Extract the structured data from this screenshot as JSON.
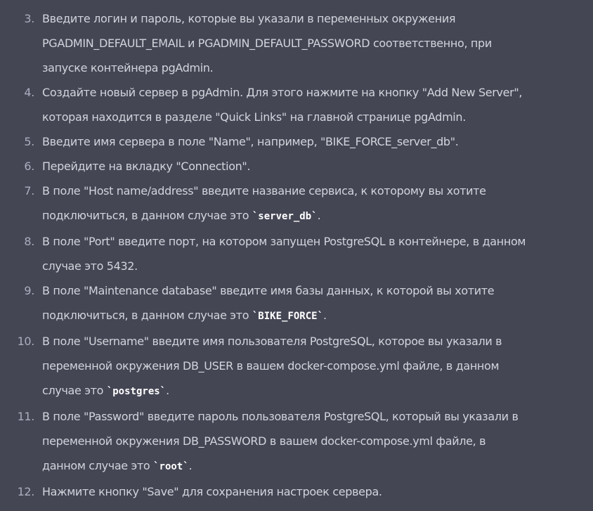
{
  "steps": [
    {
      "number": "3.",
      "lines": [
        [
          "Введите логин и пароль, которые вы указали в переменных окружения"
        ],
        [
          "PGADMIN_DEFAULT_EMAIL и PGADMIN_DEFAULT_PASSWORD соответственно, при"
        ],
        [
          "запуске контейнера pgAdmin."
        ]
      ]
    },
    {
      "number": "4.",
      "lines": [
        [
          "Создайте новый сервер в pgAdmin. Для этого нажмите на кнопку \"Add New Server\","
        ],
        [
          "которая находится в разделе \"Quick Links\" на главной странице pgAdmin."
        ]
      ]
    },
    {
      "number": "5.",
      "lines": [
        [
          "Введите имя сервера в поле \"Name\", например, \"BIKE_FORCE_server_db\"."
        ]
      ]
    },
    {
      "number": "6.",
      "lines": [
        [
          "Перейдите на вкладку \"Connection\"."
        ]
      ]
    },
    {
      "number": "7.",
      "lines": [
        [
          "В поле \"Host name/address\" введите название сервиса, к которому вы хотите"
        ],
        [
          "подключиться, в данном случае это ",
          {
            "code": "`server_db`"
          },
          "."
        ]
      ]
    },
    {
      "number": "8.",
      "lines": [
        [
          "В поле \"Port\" введите порт, на котором запущен PostgreSQL в контейнере, в данном"
        ],
        [
          "случае это 5432."
        ]
      ]
    },
    {
      "number": "9.",
      "lines": [
        [
          "В поле \"Maintenance database\" введите имя базы данных, к которой вы хотите"
        ],
        [
          "подключиться, в данном случае это ",
          {
            "code": "`BIKE_FORCE`"
          },
          "."
        ]
      ]
    },
    {
      "number": "10.",
      "lines": [
        [
          "В поле \"Username\" введите имя пользователя PostgreSQL, которое вы указали в"
        ],
        [
          "переменной окружения DB_USER в вашем docker-compose.yml файле, в данном"
        ],
        [
          "случае это ",
          {
            "code": "`postgres`"
          },
          "."
        ]
      ]
    },
    {
      "number": "11.",
      "lines": [
        [
          "В поле \"Password\" введите пароль пользователя PostgreSQL, который вы указали в"
        ],
        [
          "переменной окружения DB_PASSWORD в вашем docker-compose.yml файле, в"
        ],
        [
          "данном случае это ",
          {
            "code": "`root`"
          },
          "."
        ]
      ]
    },
    {
      "number": "12.",
      "lines": [
        [
          "Нажмите кнопку \"Save\" для сохранения настроек сервера."
        ]
      ]
    }
  ]
}
